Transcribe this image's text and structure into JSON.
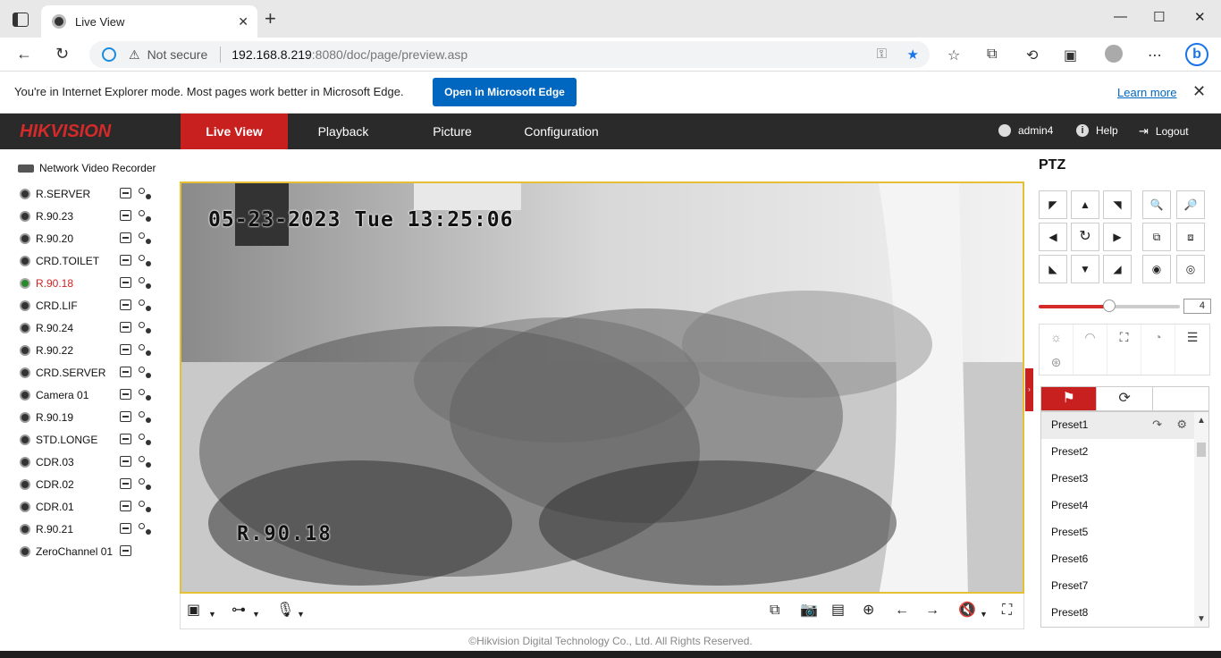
{
  "browser": {
    "tab_title": "Live View",
    "tab_close": "✕",
    "new_tab": "+",
    "minimize": "—",
    "maximize": "☐",
    "close": "✕",
    "not_secure": "Not secure",
    "url_host": "192.168.8.219",
    "url_rest": ":8080/doc/page/preview.asp"
  },
  "iebar": {
    "message": "You're in Internet Explorer mode. Most pages work better in Microsoft Edge.",
    "open_button": "Open in Microsoft Edge",
    "learn_more": "Learn more"
  },
  "header": {
    "logo": "HIKVISION",
    "nav": [
      "Live View",
      "Playback",
      "Picture",
      "Configuration"
    ],
    "user": "admin4",
    "help": "Help",
    "logout": "Logout"
  },
  "left": {
    "root": "Network Video Recorder",
    "cameras": [
      {
        "name": "R.SERVER"
      },
      {
        "name": "R.90.23"
      },
      {
        "name": "R.90.20"
      },
      {
        "name": "CRD.TOILET"
      },
      {
        "name": "R.90.18"
      },
      {
        "name": "CRD.LIF"
      },
      {
        "name": "R.90.24"
      },
      {
        "name": "R.90.22"
      },
      {
        "name": "CRD.SERVER"
      },
      {
        "name": "Camera 01"
      },
      {
        "name": "R.90.19"
      },
      {
        "name": "STD.LONGE"
      },
      {
        "name": "CDR.03"
      },
      {
        "name": "CDR.02"
      },
      {
        "name": "CDR.01"
      },
      {
        "name": "R.90.21"
      },
      {
        "name": "ZeroChannel 01"
      }
    ]
  },
  "video": {
    "osd_time": "05-23-2023 Tue 13:25:06",
    "osd_name": "R.90.18"
  },
  "ptz": {
    "title": "PTZ",
    "speed": "4",
    "presets": [
      "Preset1",
      "Preset2",
      "Preset3",
      "Preset4",
      "Preset5",
      "Preset6",
      "Preset7",
      "Preset8"
    ]
  },
  "footer": "©Hikvision Digital Technology Co., Ltd. All Rights Reserved.",
  "colors": {
    "accent": "#c8201f",
    "header_bg": "#2a2a2a",
    "edge_blue": "#0067c0",
    "video_border": "#e5c035"
  }
}
